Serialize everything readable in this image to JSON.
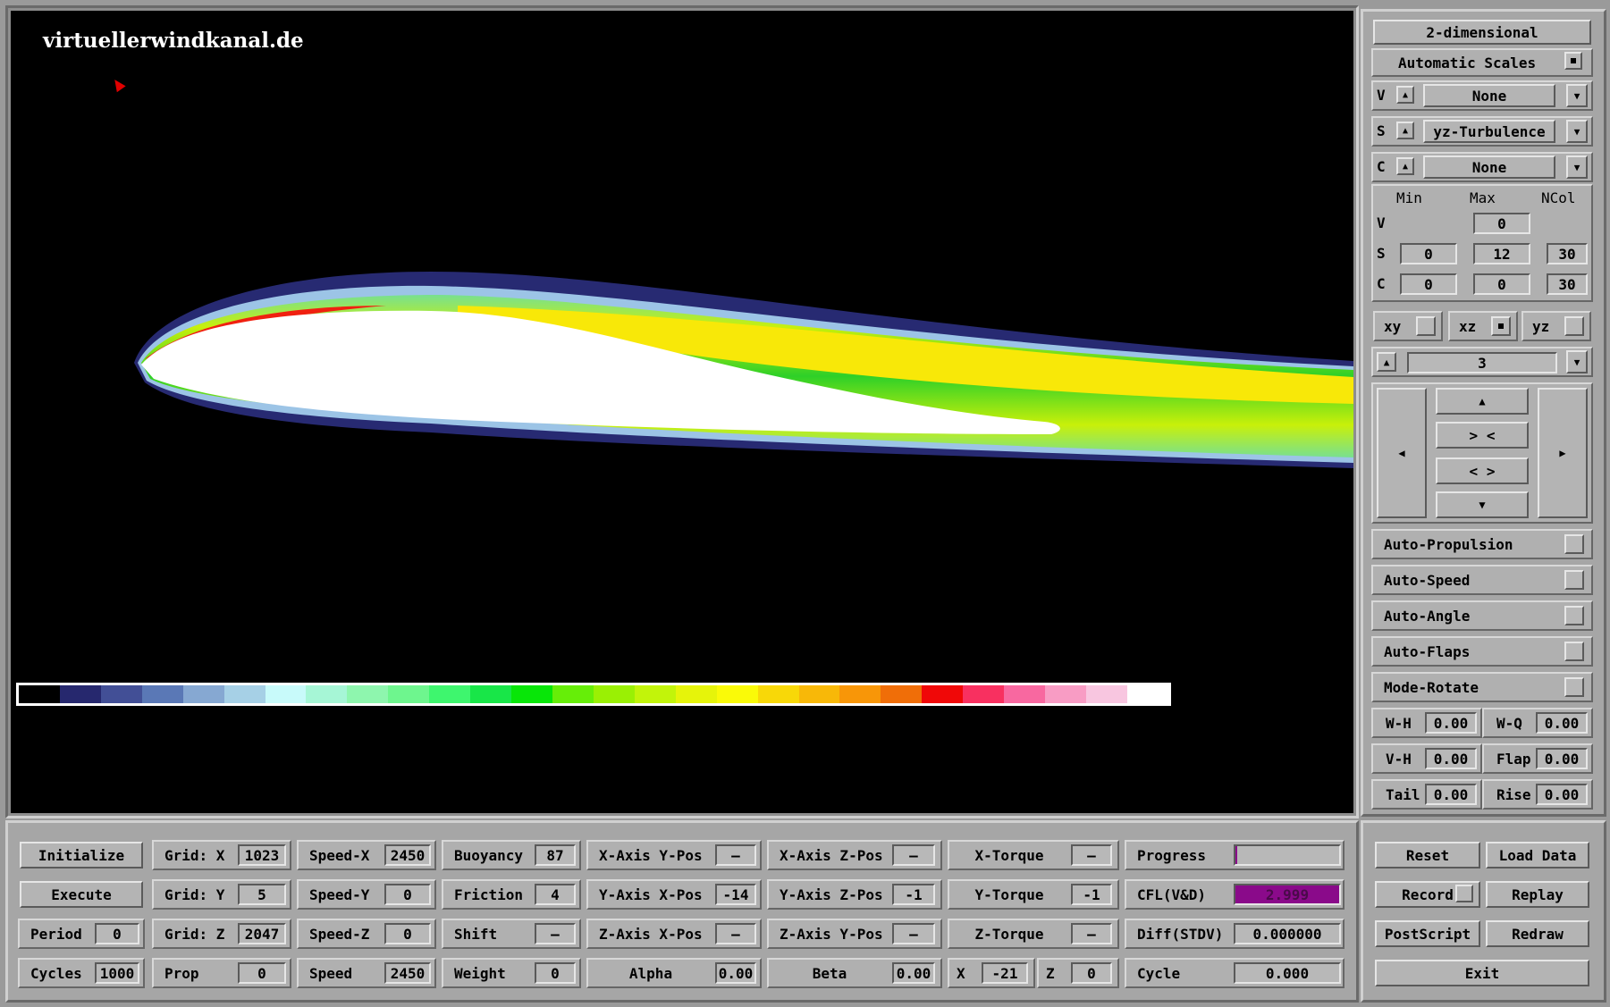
{
  "viewport": {
    "watermark": "virtuellerwindkanal.de",
    "colorbar": [
      "#000000",
      "#26286e",
      "#424f96",
      "#5a78b6",
      "#86a8d2",
      "#a6d0e6",
      "#c8fafa",
      "#a6f6d6",
      "#8ef6ae",
      "#6ef68e",
      "#3ef66e",
      "#18e648",
      "#08e608",
      "#66ee08",
      "#9af004",
      "#c2f40a",
      "#e6f40a",
      "#fafa08",
      "#f8d808",
      "#f8b808",
      "#f89608",
      "#f06e08",
      "#f00808",
      "#f83060",
      "#f868a0",
      "#f89cc4",
      "#f8c6e0",
      "#ffffff"
    ]
  },
  "side": {
    "dimension_button": "2-dimensional",
    "auto_scales": "Automatic Scales",
    "selectors": [
      {
        "key": "V",
        "value": "None"
      },
      {
        "key": "S",
        "value": "yz-Turbulence"
      },
      {
        "key": "C",
        "value": "None"
      }
    ],
    "range_headers": [
      "Min",
      "Max",
      "NCol"
    ],
    "range_rows": [
      {
        "key": "V",
        "min": "",
        "max": "0",
        "ncol": ""
      },
      {
        "key": "S",
        "min": "0",
        "max": "12",
        "ncol": "30"
      },
      {
        "key": "C",
        "min": "0",
        "max": "0",
        "ncol": "30"
      }
    ],
    "planes": [
      "xy",
      "xz",
      "yz"
    ],
    "slice_value": "3",
    "nav": {
      "up": "▲",
      "contract": "> <",
      "expand": "< >",
      "down": "▼",
      "left": "◀",
      "right": "▶"
    },
    "toggles": [
      "Auto-Propulsion",
      "Auto-Speed",
      "Auto-Angle",
      "Auto-Flaps",
      "Mode-Rotate"
    ],
    "params": [
      {
        "label": "W-H",
        "value": "0.00"
      },
      {
        "label": "W-Q",
        "value": "0.00"
      },
      {
        "label": "V-H",
        "value": "0.00"
      },
      {
        "label": "Flap",
        "value": "0.00"
      },
      {
        "label": "Tail",
        "value": "0.00"
      },
      {
        "label": "Rise",
        "value": "0.00"
      }
    ]
  },
  "bottom": {
    "buttons": {
      "initialize": "Initialize",
      "execute": "Execute"
    },
    "period": {
      "label": "Period",
      "value": "0"
    },
    "cycles": {
      "label": "Cycles",
      "value": "1000"
    },
    "grid_x": {
      "label": "Grid: X",
      "value": "1023"
    },
    "grid_y": {
      "label": "Grid: Y",
      "value": "5"
    },
    "grid_z": {
      "label": "Grid: Z",
      "value": "2047"
    },
    "prop": {
      "label": "Prop",
      "value": "0"
    },
    "speed_x": {
      "label": "Speed-X",
      "value": "2450"
    },
    "speed_y": {
      "label": "Speed-Y",
      "value": "0"
    },
    "speed_z": {
      "label": "Speed-Z",
      "value": "0"
    },
    "speed": {
      "label": "Speed",
      "value": "2450"
    },
    "buoyancy": {
      "label": "Buoyancy",
      "value": "87"
    },
    "friction": {
      "label": "Friction",
      "value": "4"
    },
    "shift": {
      "label": "Shift",
      "value": "—"
    },
    "weight": {
      "label": "Weight",
      "value": "0"
    },
    "xaxis_ypos": {
      "label": "X-Axis Y-Pos",
      "value": "—"
    },
    "yaxis_xpos": {
      "label": "Y-Axis X-Pos",
      "value": "-14"
    },
    "zaxis_xpos": {
      "label": "Z-Axis X-Pos",
      "value": "—"
    },
    "alpha": {
      "label": "Alpha",
      "value": "0.00"
    },
    "xaxis_zpos": {
      "label": "X-Axis Z-Pos",
      "value": "—"
    },
    "yaxis_zpos": {
      "label": "Y-Axis Z-Pos",
      "value": "-1"
    },
    "zaxis_ypos": {
      "label": "Z-Axis Y-Pos",
      "value": "—"
    },
    "beta": {
      "label": "Beta",
      "value": "0.00"
    },
    "x_torque": {
      "label": "X-Torque",
      "value": "—"
    },
    "y_torque": {
      "label": "Y-Torque",
      "value": "-1"
    },
    "z_torque": {
      "label": "Z-Torque",
      "value": "—"
    },
    "x": {
      "label": "X",
      "value": "-21"
    },
    "z": {
      "label": "Z",
      "value": "0"
    },
    "progress": {
      "label": "Progress",
      "value": 0
    },
    "cfl": {
      "label": "CFL(V&D)",
      "value": "2.999"
    },
    "diff": {
      "label": "Diff(STDV)",
      "value": "0.000000"
    },
    "cycle": {
      "label": "Cycle",
      "value": "0.000"
    },
    "right_buttons": {
      "reset": "Reset",
      "load": "Load Data",
      "record": "Record",
      "replay": "Replay",
      "postscript": "PostScript",
      "redraw": "Redraw",
      "exit": "Exit"
    }
  },
  "colors": {
    "cfl_fill": "#8a0a8a",
    "panel": "#a6a6a6"
  }
}
